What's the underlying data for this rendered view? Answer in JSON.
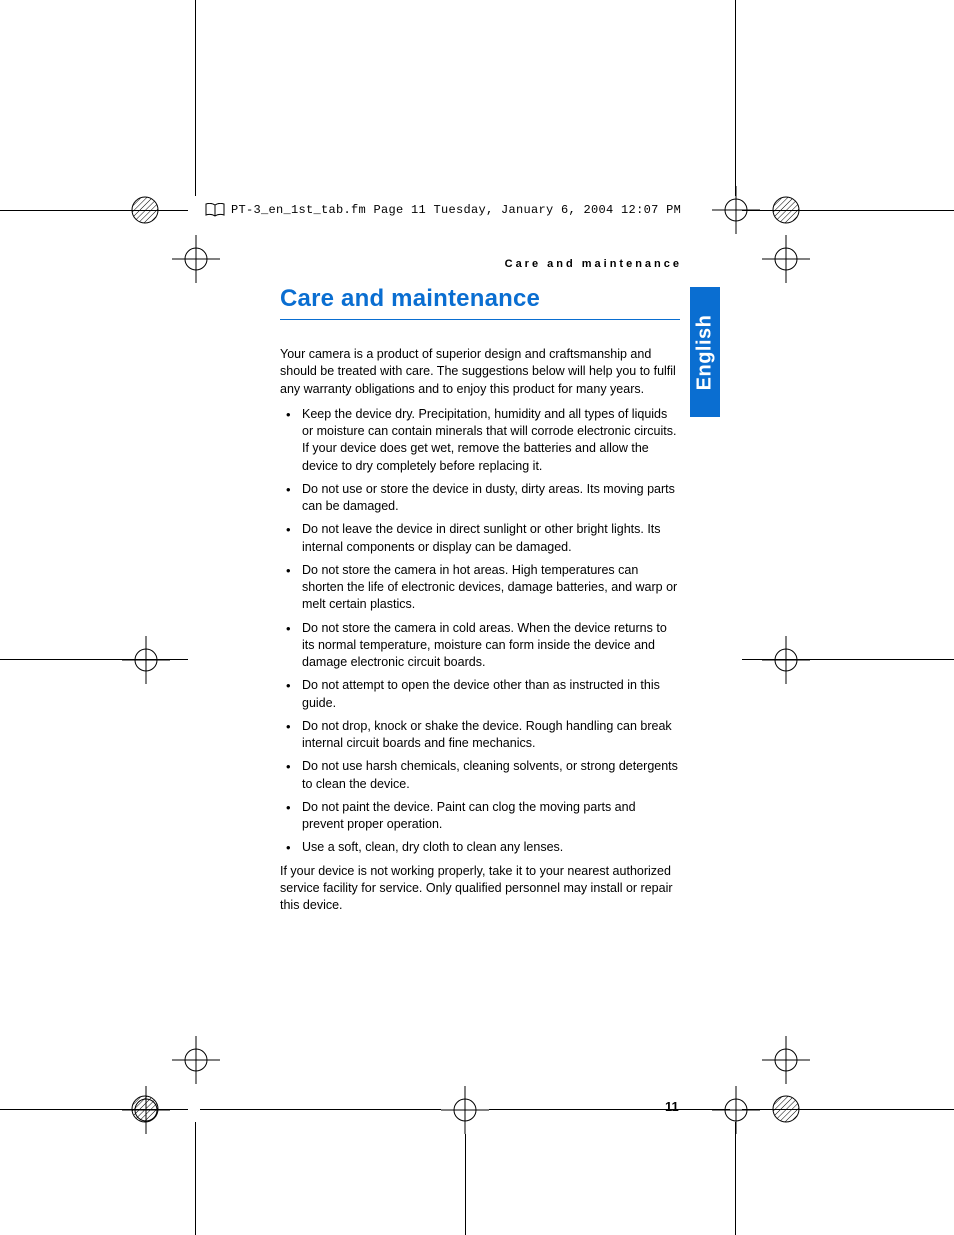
{
  "slug": "PT-3_en_1st_tab.fm  Page 11  Tuesday, January 6, 2004  12:07 PM",
  "running_header": "Care and maintenance",
  "language_tab": "English",
  "page_number": "11",
  "heading": "Care and maintenance",
  "intro": "Your camera is a product of superior design and craftsmanship and should be treated with care. The suggestions below will help you to fulfil any warranty obligations and to enjoy this product for many years.",
  "bullets": [
    "Keep the device dry. Precipitation, humidity and all types of liquids or moisture can contain minerals that will corrode electronic circuits. If your device does get wet, remove the batteries and allow the device to dry completely before replacing it.",
    "Do not use or store the device in dusty, dirty areas. Its moving parts can be damaged.",
    "Do not leave the device in direct sunlight or other bright lights. Its internal components or display can be damaged.",
    "Do not store the camera in hot areas. High temperatures can shorten the life of electronic devices, damage batteries, and warp or melt certain plastics.",
    "Do not store the camera in cold areas. When the device returns to its normal temperature, moisture can form inside the device and damage electronic circuit boards.",
    "Do not attempt to open the device other than as instructed in this guide.",
    "Do not drop, knock or shake the device. Rough handling can break internal circuit boards and fine mechanics.",
    "Do not use harsh chemicals, cleaning solvents, or strong detergents to clean the device.",
    "Do not paint the device. Paint can clog the moving parts and prevent proper operation.",
    "Use a soft, clean, dry cloth to clean any lenses."
  ],
  "outro": "If your device is not working properly, take it to your nearest authorized service facility for service. Only qualified personnel may install or repair this device."
}
